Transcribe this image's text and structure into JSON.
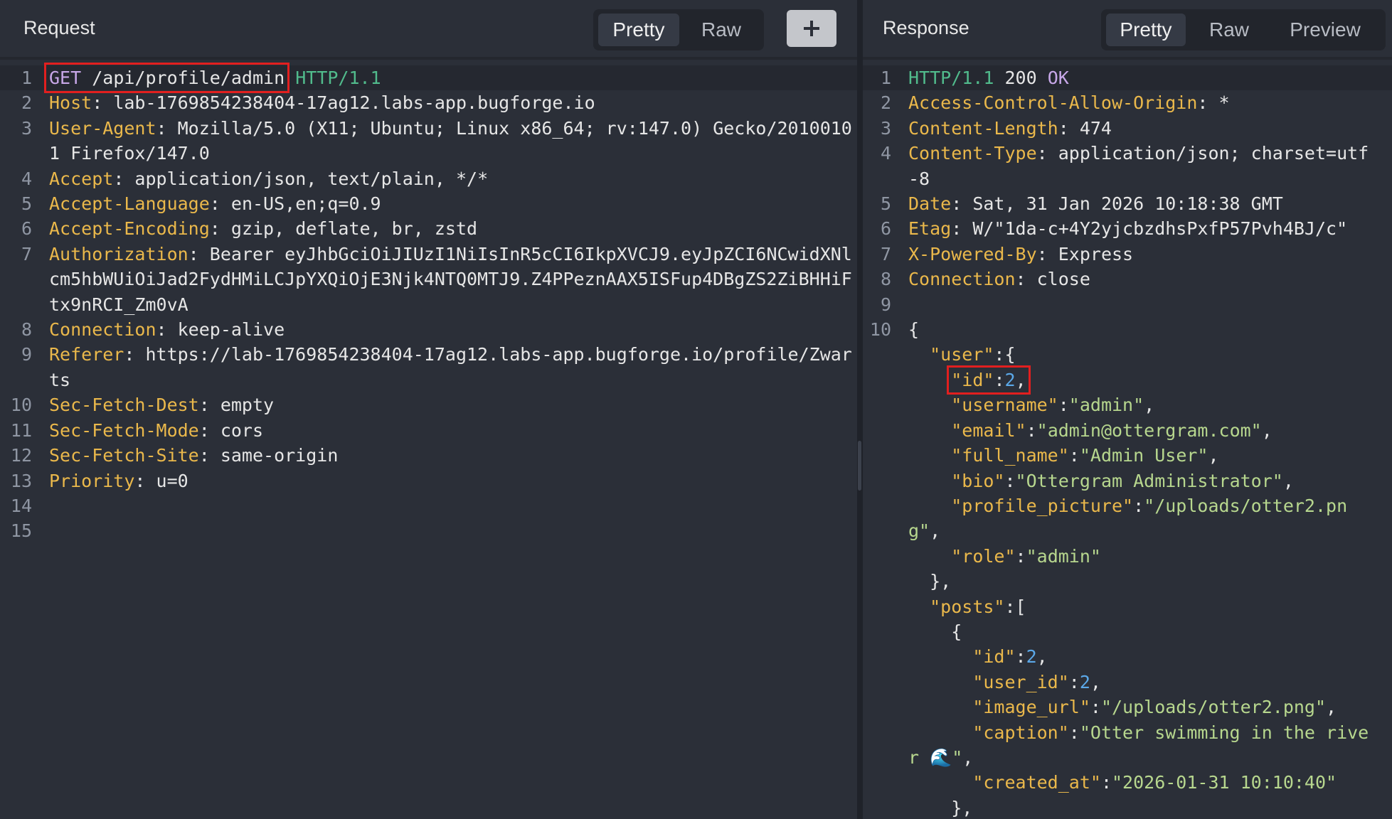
{
  "request": {
    "title": "Request",
    "tabs": [
      {
        "label": "Pretty",
        "active": true
      },
      {
        "label": "Raw",
        "active": false
      }
    ],
    "add_button_icon": "plus-icon",
    "lines": [
      {
        "n": "1",
        "method": "GET",
        "path": "/api/profile/admin",
        "protocol": "HTTP/1.1"
      },
      {
        "n": "2",
        "name": "Host",
        "value": "lab-1769854238404-17ag12.labs-app.bugforge.io"
      },
      {
        "n": "3",
        "name": "User-Agent",
        "value": "Mozilla/5.0 (X11; Ubuntu; Linux x86_64; rv:147.0) Gecko/20100101 Firefox/147.0"
      },
      {
        "n": "4",
        "name": "Accept",
        "value": "application/json, text/plain, */*"
      },
      {
        "n": "5",
        "name": "Accept-Language",
        "value": "en-US,en;q=0.9"
      },
      {
        "n": "6",
        "name": "Accept-Encoding",
        "value": "gzip, deflate, br, zstd"
      },
      {
        "n": "7",
        "name": "Authorization",
        "value": "Bearer eyJhbGciOiJIUzI1NiIsInR5cCI6IkpXVCJ9.eyJpZCI6NCwidXNlcm5hbWUiOiJad2FydHMiLCJpYXQiOjE3Njk4NTQ0MTJ9.Z4PPeznAAX5ISFup4DBgZS2ZiBHHiFtx9nRCI_Zm0vA"
      },
      {
        "n": "8",
        "name": "Connection",
        "value": "keep-alive"
      },
      {
        "n": "9",
        "name": "Referer",
        "value": "https://lab-1769854238404-17ag12.labs-app.bugforge.io/profile/Zwarts"
      },
      {
        "n": "10",
        "name": "Sec-Fetch-Dest",
        "value": "empty"
      },
      {
        "n": "11",
        "name": "Sec-Fetch-Mode",
        "value": "cors"
      },
      {
        "n": "12",
        "name": "Sec-Fetch-Site",
        "value": "same-origin"
      },
      {
        "n": "13",
        "name": "Priority",
        "value": "u=0"
      },
      {
        "n": "14"
      },
      {
        "n": "15"
      }
    ]
  },
  "response": {
    "title": "Response",
    "tabs": [
      {
        "label": "Pretty",
        "active": true
      },
      {
        "label": "Raw",
        "active": false
      },
      {
        "label": "Preview",
        "active": false
      }
    ],
    "status_line": {
      "n": "1",
      "protocol": "HTTP/1.1",
      "code": "200",
      "reason": "OK"
    },
    "headers": [
      {
        "n": "2",
        "name": "Access-Control-Allow-Origin",
        "value": "*"
      },
      {
        "n": "3",
        "name": "Content-Length",
        "value": "474"
      },
      {
        "n": "4",
        "name": "Content-Type",
        "value": "application/json; charset=utf-8"
      },
      {
        "n": "5",
        "name": "Date",
        "value": "Sat, 31 Jan 2026 10:18:38 GMT"
      },
      {
        "n": "6",
        "name": "Etag",
        "value": "W/\"1da-c+4Y2yjcbzdhsPxfP57Pvh4BJ/c\""
      },
      {
        "n": "7",
        "name": "X-Powered-By",
        "value": "Express"
      },
      {
        "n": "8",
        "name": "Connection",
        "value": "close"
      },
      {
        "n": "9"
      }
    ],
    "body_line_number": "10",
    "body": {
      "open_brace": "{",
      "user_key": "\"user\"",
      "user": [
        {
          "key": "\"id\"",
          "value": "2",
          "kind": "num",
          "highlight": true
        },
        {
          "key": "\"username\"",
          "value": "\"admin\"",
          "kind": "str"
        },
        {
          "key": "\"email\"",
          "value": "\"admin@ottergram.com\"",
          "kind": "str"
        },
        {
          "key": "\"full_name\"",
          "value": "\"Admin User\"",
          "kind": "str"
        },
        {
          "key": "\"bio\"",
          "value": "\"Ottergram Administrator\"",
          "kind": "str"
        },
        {
          "key": "\"profile_picture\"",
          "value": "\"/uploads/otter2.png\"",
          "kind": "str"
        },
        {
          "key": "\"role\"",
          "value": "\"admin\"",
          "kind": "str",
          "last": true
        }
      ],
      "posts_key": "\"posts\"",
      "post": [
        {
          "key": "\"id\"",
          "value": "2",
          "kind": "num"
        },
        {
          "key": "\"user_id\"",
          "value": "2",
          "kind": "num"
        },
        {
          "key": "\"image_url\"",
          "value": "\"/uploads/otter2.png\"",
          "kind": "str"
        },
        {
          "key": "\"caption\"",
          "value": "\"Otter swimming in the river 🌊\"",
          "kind": "str"
        },
        {
          "key": "\"created_at\"",
          "value": "\"2026-01-31 10:10:40\"",
          "kind": "str",
          "last": true
        }
      ]
    }
  },
  "colors": {
    "background": "#2b2f38",
    "header_name": "#eab84b",
    "method": "#c7a7e8",
    "protocol": "#51bb8c",
    "json_string": "#b7d78e",
    "json_number": "#5ba8e8",
    "highlight_box": "#e21f1f"
  }
}
